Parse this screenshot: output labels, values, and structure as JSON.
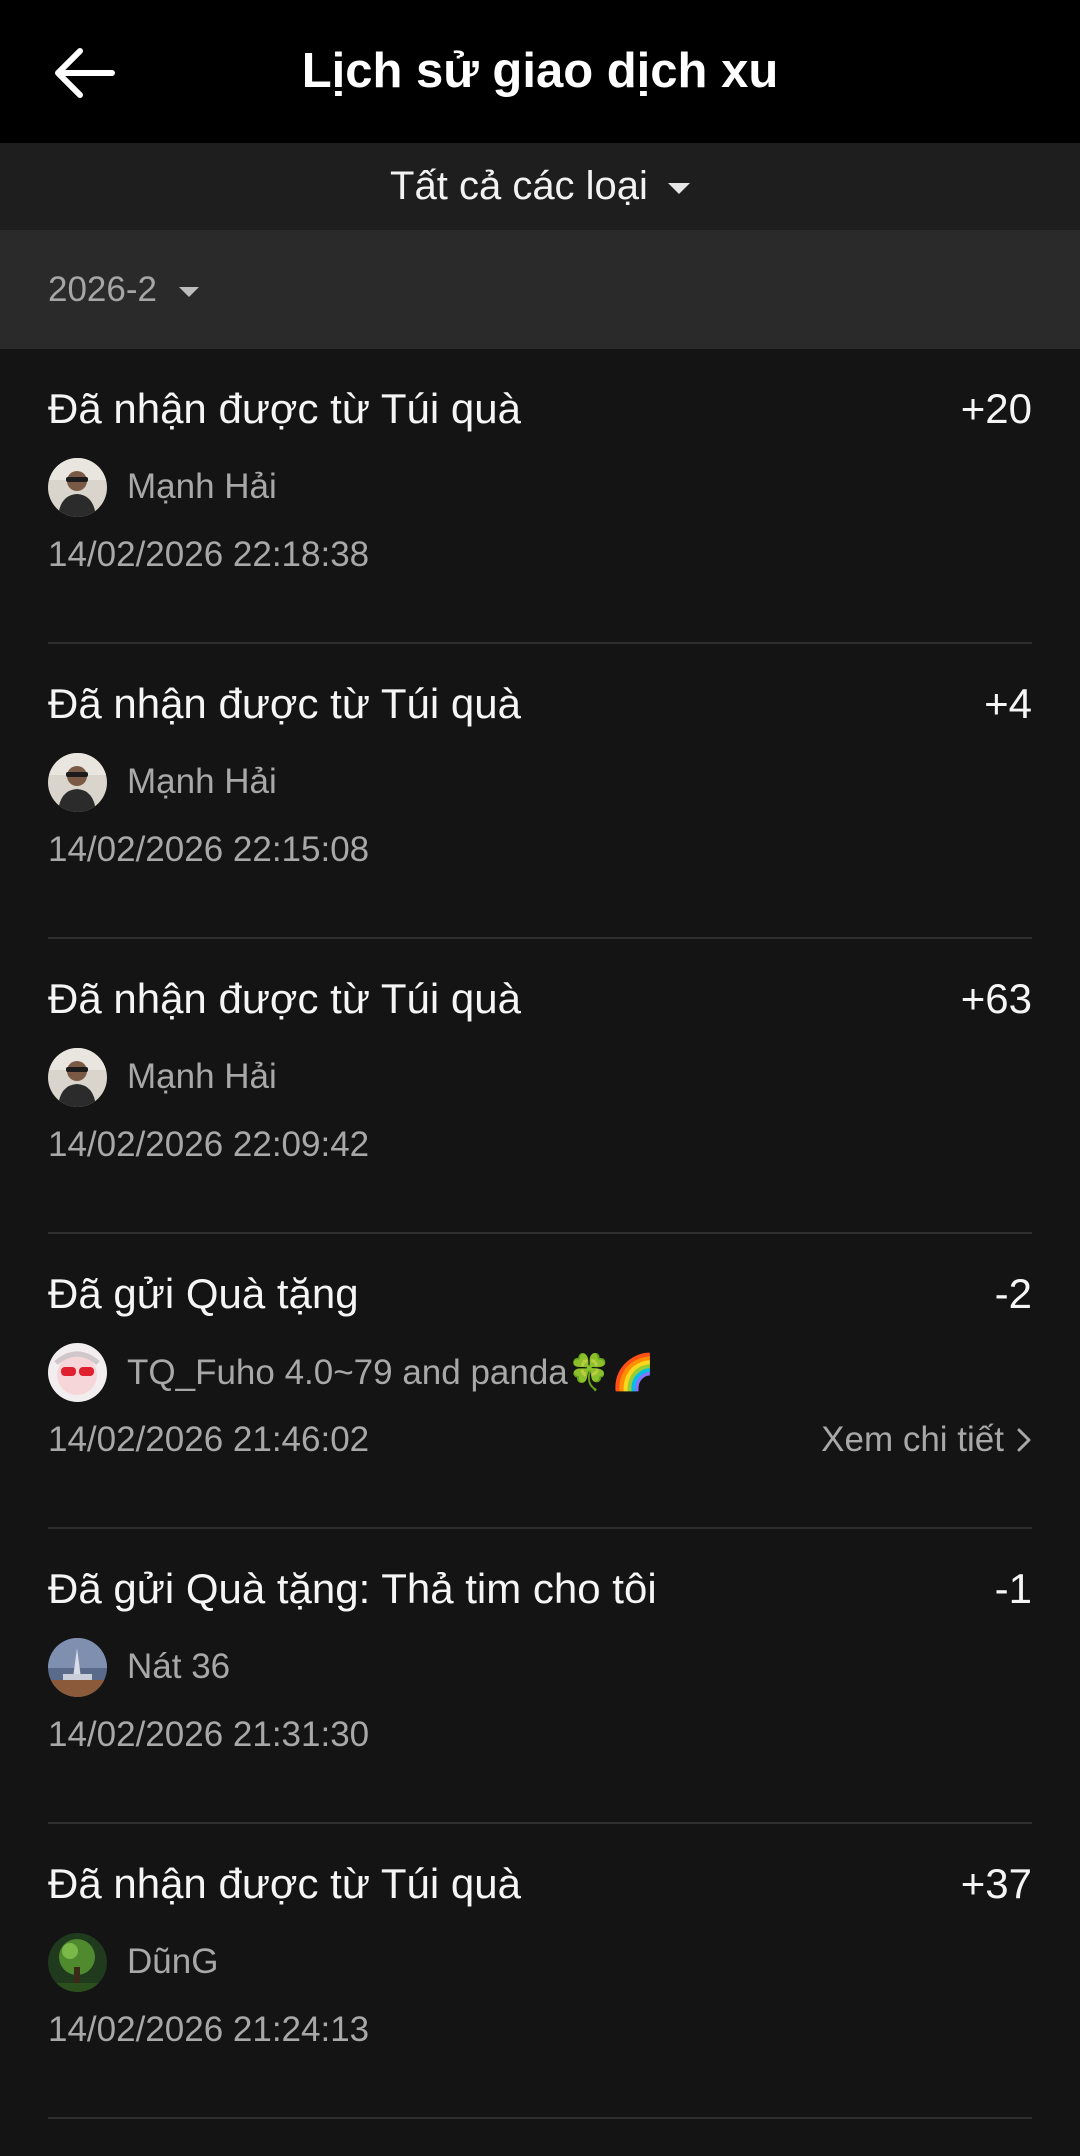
{
  "header": {
    "title": "Lịch sử giao dịch xu",
    "back_icon": "arrow-left-icon"
  },
  "filter": {
    "label": "Tất cả các loại"
  },
  "month": {
    "label": "2026-2"
  },
  "colors": {
    "background": "#141414",
    "header": "#000000",
    "filter_bar": "#1e1e1e",
    "month_bar": "#2a2a2a",
    "text_primary": "#f5f5f5",
    "text_secondary": "#a8a8a8"
  },
  "transactions": [
    {
      "title": "Đã nhận được từ Túi quà",
      "amount": "+20",
      "user": "Mạnh Hải",
      "time": "14/02/2026 22:18:38"
    },
    {
      "title": "Đã nhận được từ Túi quà",
      "amount": "+4",
      "user": "Mạnh Hải",
      "time": "14/02/2026 22:15:08"
    },
    {
      "title": "Đã nhận được từ Túi quà",
      "amount": "+63",
      "user": "Mạnh Hải",
      "time": "14/02/2026 22:09:42"
    },
    {
      "title": "Đã gửi Quà tặng",
      "amount": "-2",
      "user": "TQ_Fuho 4.0~79 and panda🍀🌈",
      "time": "14/02/2026 21:46:02",
      "detail": "Xem chi tiết"
    },
    {
      "title": "Đã gửi Quà tặng: Thả tim cho tôi",
      "amount": "-1",
      "user": "Nát 36",
      "time": "14/02/2026 21:31:30"
    },
    {
      "title": "Đã nhận được từ Túi quà",
      "amount": "+37",
      "user": "DũnG",
      "time": "14/02/2026 21:24:13"
    }
  ]
}
